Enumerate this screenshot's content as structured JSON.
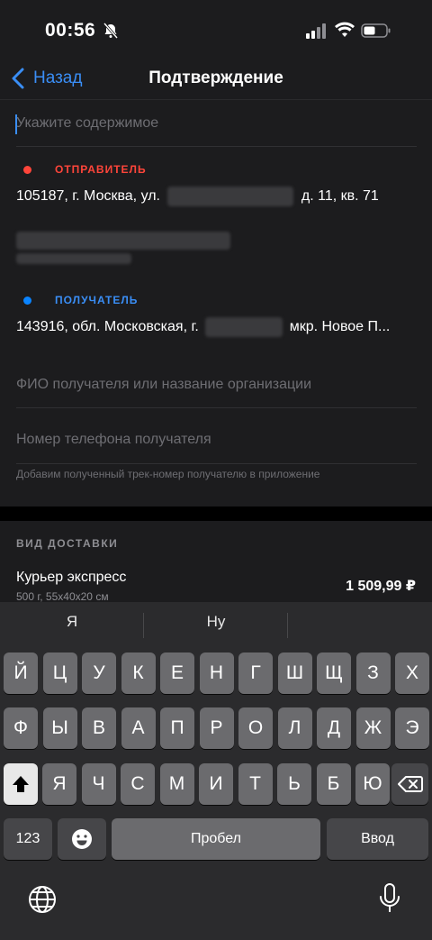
{
  "status_bar": {
    "time": "00:56"
  },
  "nav": {
    "back_label": "Назад",
    "title": "Подтверждение"
  },
  "form": {
    "content_placeholder": "Укажите содержимое",
    "sender": {
      "label": "ОТПРАВИТЕЛЬ",
      "address_prefix": "105187, г. Москва, ул.",
      "address_suffix": "д. 11, кв. 71",
      "dot_color": "#ff453a"
    },
    "recipient": {
      "label": "ПОЛУЧАТЕЛЬ",
      "address_prefix": "143916, обл. Московская, г.",
      "address_suffix": "мкр. Новое П...",
      "dot_color": "#0a84ff"
    },
    "name_placeholder": "ФИО получателя или название организации",
    "phone_placeholder": "Номер телефона получателя",
    "hint": "Добавим полученный трек-номер получателю в приложение"
  },
  "delivery": {
    "section_label": "ВИД ДОСТАВКИ",
    "name": "Курьер экспресс",
    "dims": "500 г, 55x40x20 см",
    "price": "1 509,99 ₽"
  },
  "keyboard": {
    "suggestions": [
      "Я",
      "Ну"
    ],
    "row1": [
      "Й",
      "Ц",
      "У",
      "К",
      "Е",
      "Н",
      "Г",
      "Ш",
      "Щ",
      "З",
      "Х"
    ],
    "row2": [
      "Ф",
      "Ы",
      "В",
      "А",
      "П",
      "Р",
      "О",
      "Л",
      "Д",
      "Ж",
      "Э"
    ],
    "row3": [
      "Я",
      "Ч",
      "С",
      "М",
      "И",
      "Т",
      "Ь",
      "Б",
      "Ю"
    ],
    "numbers_label": "123",
    "space_label": "Пробел",
    "return_label": "Ввод"
  },
  "colors": {
    "accent": "#3a8ef6",
    "sender": "#ff453a",
    "recipient": "#0a84ff"
  }
}
